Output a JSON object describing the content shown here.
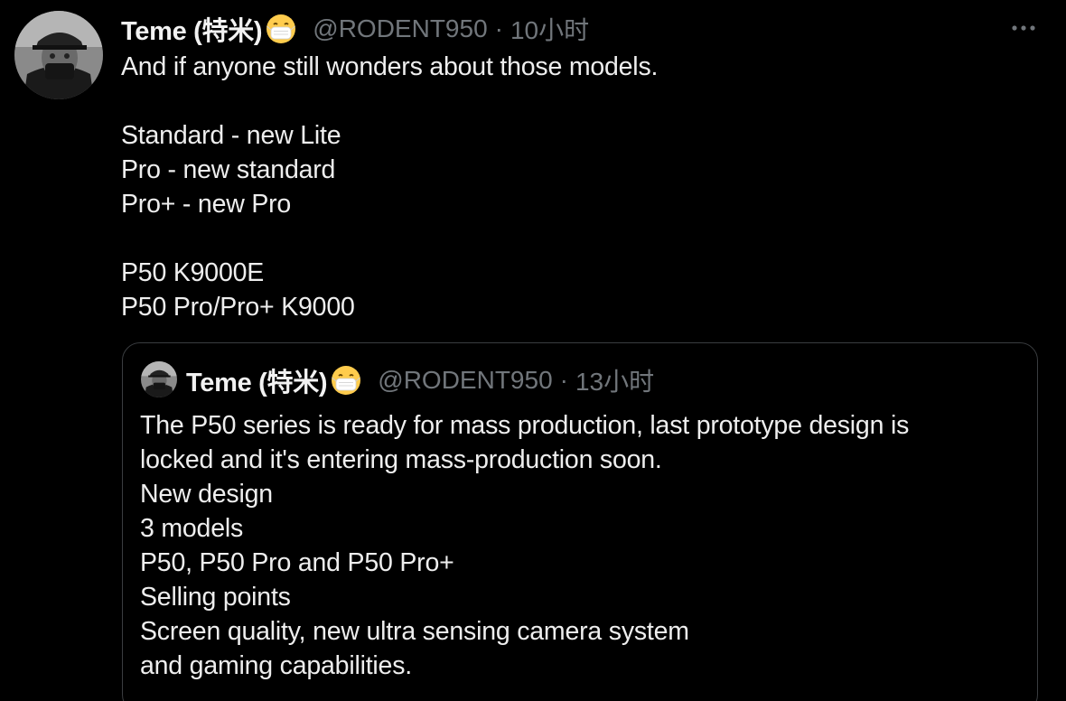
{
  "tweet": {
    "display_name": "Teme (特米)",
    "handle": "@RODENT950",
    "separator": "·",
    "time": "10小时",
    "emoji": "face-with-medical-mask-icon",
    "text": "And if anyone still wonders about those models.\n\nStandard - new Lite\nPro - new standard\nPro+ - new Pro\n\nP50 K9000E\nP50 Pro/Pro+ K9000"
  },
  "quoted_tweet": {
    "display_name": "Teme (特米)",
    "handle": "@RODENT950",
    "separator": "·",
    "time": "13小时",
    "emoji": "face-with-medical-mask-icon",
    "text": "The P50 series is ready for mass production, last prototype design is\nlocked and it's entering mass-production soon.\nNew design\n3 models\nP50, P50 Pro and P50 Pro+\nSelling points\nScreen quality, new ultra sensing camera system\nand gaming capabilities."
  },
  "colors": {
    "background": "#000000",
    "text": "#eeeeee",
    "secondary": "#71767b",
    "border": "#3a3d40"
  }
}
